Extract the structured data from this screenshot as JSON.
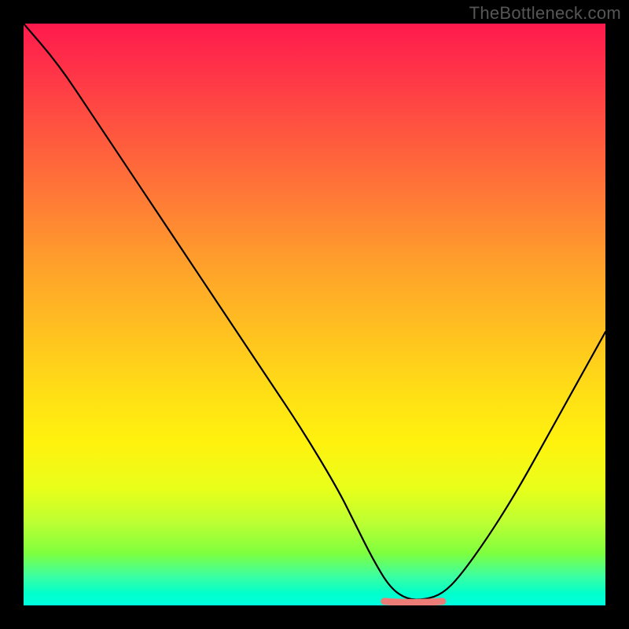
{
  "watermark": "TheBottleneck.com",
  "chart_data": {
    "type": "line",
    "title": "",
    "xlabel": "",
    "ylabel": "",
    "xlim": [
      0,
      100
    ],
    "ylim": [
      0,
      100
    ],
    "series": [
      {
        "name": "bottleneck-curve",
        "x": [
          0,
          6,
          12,
          18,
          24,
          30,
          36,
          42,
          48,
          54,
          57,
          60,
          63,
          66,
          69,
          72,
          75,
          80,
          85,
          90,
          95,
          100
        ],
        "values": [
          100,
          93,
          84,
          75,
          66,
          57,
          48,
          39,
          30,
          20,
          14,
          8,
          3,
          1,
          1,
          2,
          5,
          12,
          20,
          29,
          38,
          47
        ]
      }
    ],
    "marker": {
      "name": "optimal-range-marker",
      "x_start": 62,
      "x_end": 72,
      "y": 0.7,
      "color": "#ec7c78"
    },
    "gradient_stops": [
      {
        "pos": 0,
        "color": "#ff1a4d"
      },
      {
        "pos": 8,
        "color": "#ff3348"
      },
      {
        "pos": 18,
        "color": "#ff5440"
      },
      {
        "pos": 30,
        "color": "#ff7a36"
      },
      {
        "pos": 42,
        "color": "#ffa22a"
      },
      {
        "pos": 54,
        "color": "#ffc41f"
      },
      {
        "pos": 64,
        "color": "#ffe015"
      },
      {
        "pos": 72,
        "color": "#fff20e"
      },
      {
        "pos": 80,
        "color": "#e8ff1a"
      },
      {
        "pos": 86,
        "color": "#baff33"
      },
      {
        "pos": 91,
        "color": "#7fff3e"
      },
      {
        "pos": 95,
        "color": "#3bffa2"
      },
      {
        "pos": 98,
        "color": "#00ffcc"
      },
      {
        "pos": 100,
        "color": "#00ffe0"
      }
    ]
  }
}
